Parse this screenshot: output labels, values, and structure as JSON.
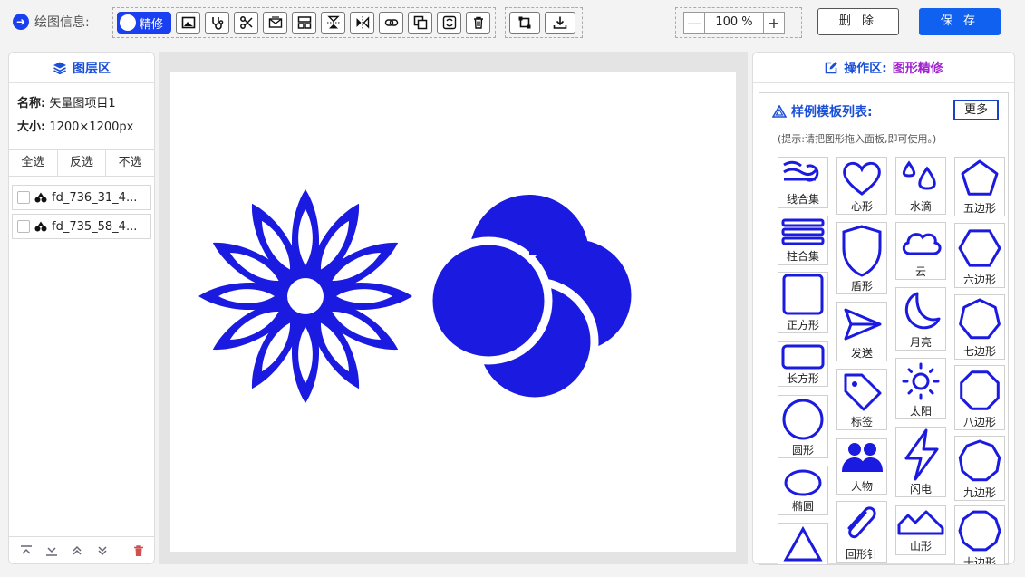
{
  "toolbar": {
    "title": "绘图信息:",
    "toggle_label": "精修",
    "tools": [
      "image-icon",
      "stethoscope-icon",
      "scissors-icon",
      "mail-icon",
      "layout-icon",
      "flip-vertical-icon",
      "flip-horizontal-icon",
      "link-icon",
      "copy-icon",
      "replace-icon",
      "trash-icon"
    ],
    "canvas_tools": [
      "crop-icon",
      "download-icon"
    ],
    "zoom_out": "—",
    "zoom_value": "100 %",
    "zoom_in": "+",
    "delete_label": "删 除",
    "save_label": "保 存"
  },
  "layers_panel": {
    "title": "图层区",
    "name_label": "名称:",
    "name_value": "矢量图项目1",
    "size_label": "大小:",
    "size_value": "1200×1200px",
    "select_all": "全选",
    "invert": "反选",
    "select_none": "不选",
    "items": [
      {
        "label": "fd_736_31_4..."
      },
      {
        "label": "fd_735_58_4..."
      }
    ]
  },
  "ops_panel": {
    "title": "操作区:",
    "mode": "图形精修",
    "template_title": "样例模板列表:",
    "more": "更多",
    "hint": "(提示:请把图形拖入面板,即可使用。)",
    "templates": {
      "col1": [
        "线合集",
        "柱合集",
        "正方形",
        "长方形",
        "圆形",
        "椭圆",
        ""
      ],
      "col2": [
        "心形",
        "盾形",
        "发送",
        "标签",
        "人物",
        "回形针"
      ],
      "col3": [
        "水滴",
        "云",
        "月亮",
        "太阳",
        "闪电",
        "山形"
      ],
      "col4": [
        "五边形",
        "六边形",
        "七边形",
        "八边形",
        "九边形",
        "十边形"
      ]
    }
  },
  "colors": {
    "accent": "#1a3ff0",
    "shape": "#1a1ae0",
    "save": "#1061f0",
    "mode": "#a025d0"
  }
}
